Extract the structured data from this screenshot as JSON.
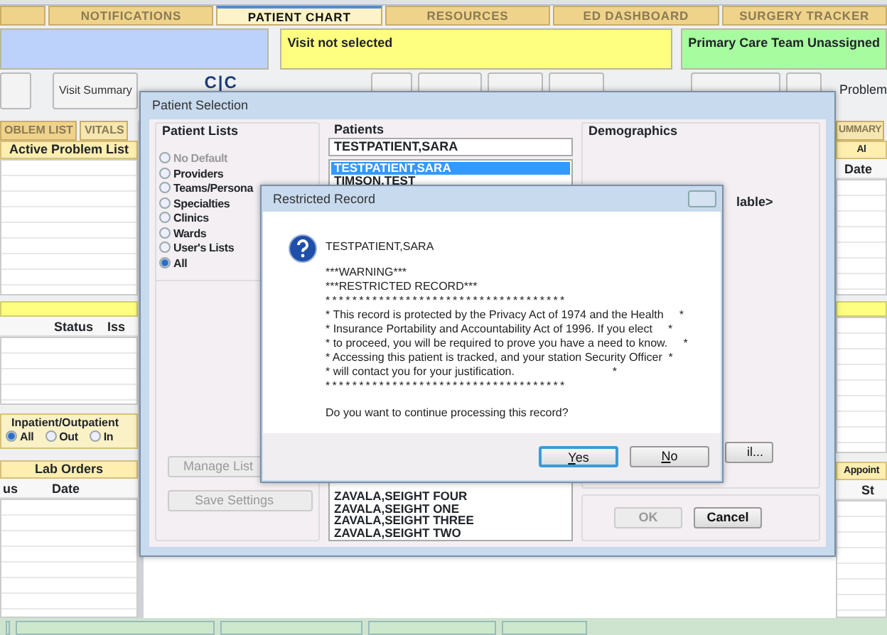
{
  "top_tabs": [
    {
      "label": "NOTIFICATIONS",
      "selected": false
    },
    {
      "label": "PATIENT CHART",
      "selected": true
    },
    {
      "label": "RESOURCES",
      "selected": false
    },
    {
      "label": "ED DASHBOARD",
      "selected": false
    },
    {
      "label": "SURGERY TRACKER",
      "selected": false
    }
  ],
  "banners": {
    "visit": "Visit not selected",
    "care_team": "Primary Care Team Unassigned"
  },
  "toolbar": {
    "visit_summary": "Visit Summary",
    "logo": "C|C",
    "problem_label": "Problem"
  },
  "left_panel": {
    "tabs": [
      {
        "label": "OBLEM LIST",
        "selected": true
      },
      {
        "label": "VITALS",
        "selected": false
      }
    ],
    "problem_header": "Active Problem List",
    "status_columns": [
      "Status",
      "Iss"
    ],
    "inpatient_outpatient": {
      "title": "Inpatient/Outpatient",
      "options": [
        {
          "label": "All",
          "selected": true
        },
        {
          "label": "Out",
          "selected": false
        },
        {
          "label": "In",
          "selected": false
        }
      ]
    },
    "lab_header": "Lab Orders",
    "lab_columns": [
      "us",
      "Date"
    ]
  },
  "right_panel": {
    "tab": "UMMARY",
    "header": "Al",
    "column": "Date",
    "appointments_header": "Appoint",
    "appointments_column": "St"
  },
  "patient_selection": {
    "title": "Patient Selection",
    "lists_title": "Patient Lists",
    "list_options": [
      {
        "label": "No Default",
        "selected": false,
        "disabled": true
      },
      {
        "label": "Providers",
        "selected": false,
        "disabled": false
      },
      {
        "label": "Teams/Persona",
        "selected": false,
        "disabled": false
      },
      {
        "label": "Specialties",
        "selected": false,
        "disabled": false
      },
      {
        "label": "Clinics",
        "selected": false,
        "disabled": false
      },
      {
        "label": "Wards",
        "selected": false,
        "disabled": false
      },
      {
        "label": "User's Lists",
        "selected": false,
        "disabled": false
      },
      {
        "label": "All",
        "selected": true,
        "disabled": false
      }
    ],
    "manage_list": {
      "label": "Manage List",
      "disabled": true
    },
    "save_settings": {
      "label": "Save Settings",
      "disabled": true
    },
    "patients_title": "Patients",
    "search_value": "TESTPATIENT,SARA",
    "patients_top": [
      {
        "name": "TESTPATIENT,SARA",
        "selected": true
      },
      {
        "name": "TIMSON,TEST",
        "selected": false
      }
    ],
    "patients_bottom": [
      {
        "name": "ZAVALA,SEIGHT FOUR",
        "selected": false
      },
      {
        "name": "ZAVALA,SEIGHT ONE",
        "selected": false
      },
      {
        "name": "ZAVALA,SEIGHT THREE",
        "selected": false
      },
      {
        "name": "ZAVALA,SEIGHT TWO",
        "selected": false
      }
    ],
    "demographics_title": "Demographics",
    "demographics_text": "lable>",
    "detail_button": "il...",
    "ok": {
      "label": "OK",
      "disabled": true
    },
    "cancel": {
      "label": "Cancel",
      "disabled": false
    }
  },
  "restricted_dialog": {
    "title": "Restricted Record",
    "patient": "TESTPATIENT,SARA",
    "message_lines": [
      "***WARNING***",
      "***RESTRICTED RECORD***",
      "************************************",
      "* This record is protected by the Privacy Act of 1974 and the Health     *",
      "* Insurance Portability and Accountability Act of 1996. If you elect     *",
      "* to proceed, you will be required to prove you have a need to know.     *",
      "* Accessing this patient is tracked, and your station Security Officer  *",
      "* will contact you for your justification.                               *",
      "************************************"
    ],
    "question": "Do you want to continue processing this record?",
    "buttons": [
      {
        "label": "Yes",
        "default": true
      },
      {
        "label": "No",
        "default": false
      }
    ]
  }
}
